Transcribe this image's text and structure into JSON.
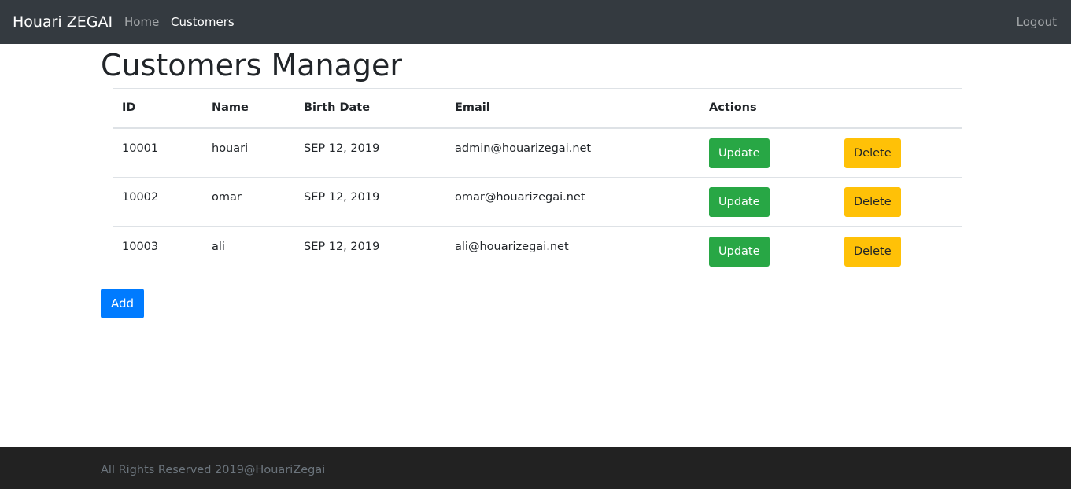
{
  "navbar": {
    "brand": "Houari ZEGAI",
    "links": [
      {
        "label": "Home"
      },
      {
        "label": "Customers"
      }
    ],
    "logout_label": "Logout"
  },
  "main": {
    "title": "Customers Manager",
    "table": {
      "headers": [
        "ID",
        "Name",
        "Birth Date",
        "Email",
        "Actions"
      ],
      "rows": [
        {
          "id": "10001",
          "name": "houari",
          "birth_date": "SEP 12, 2019",
          "email": "admin@houarizegai.net"
        },
        {
          "id": "10002",
          "name": "omar",
          "birth_date": "SEP 12, 2019",
          "email": "omar@houarizegai.net"
        },
        {
          "id": "10003",
          "name": "ali",
          "birth_date": "SEP 12, 2019",
          "email": "ali@houarizegai.net"
        }
      ],
      "update_label": "Update",
      "delete_label": "Delete"
    },
    "add_label": "Add"
  },
  "footer": {
    "text": "All Rights Reserved 2019@HouariZegai"
  },
  "colors": {
    "navbar_bg": "#343a40",
    "footer_bg": "#222222",
    "update_button": "#28a745",
    "delete_button": "#ffc107",
    "add_button": "#007bff"
  }
}
